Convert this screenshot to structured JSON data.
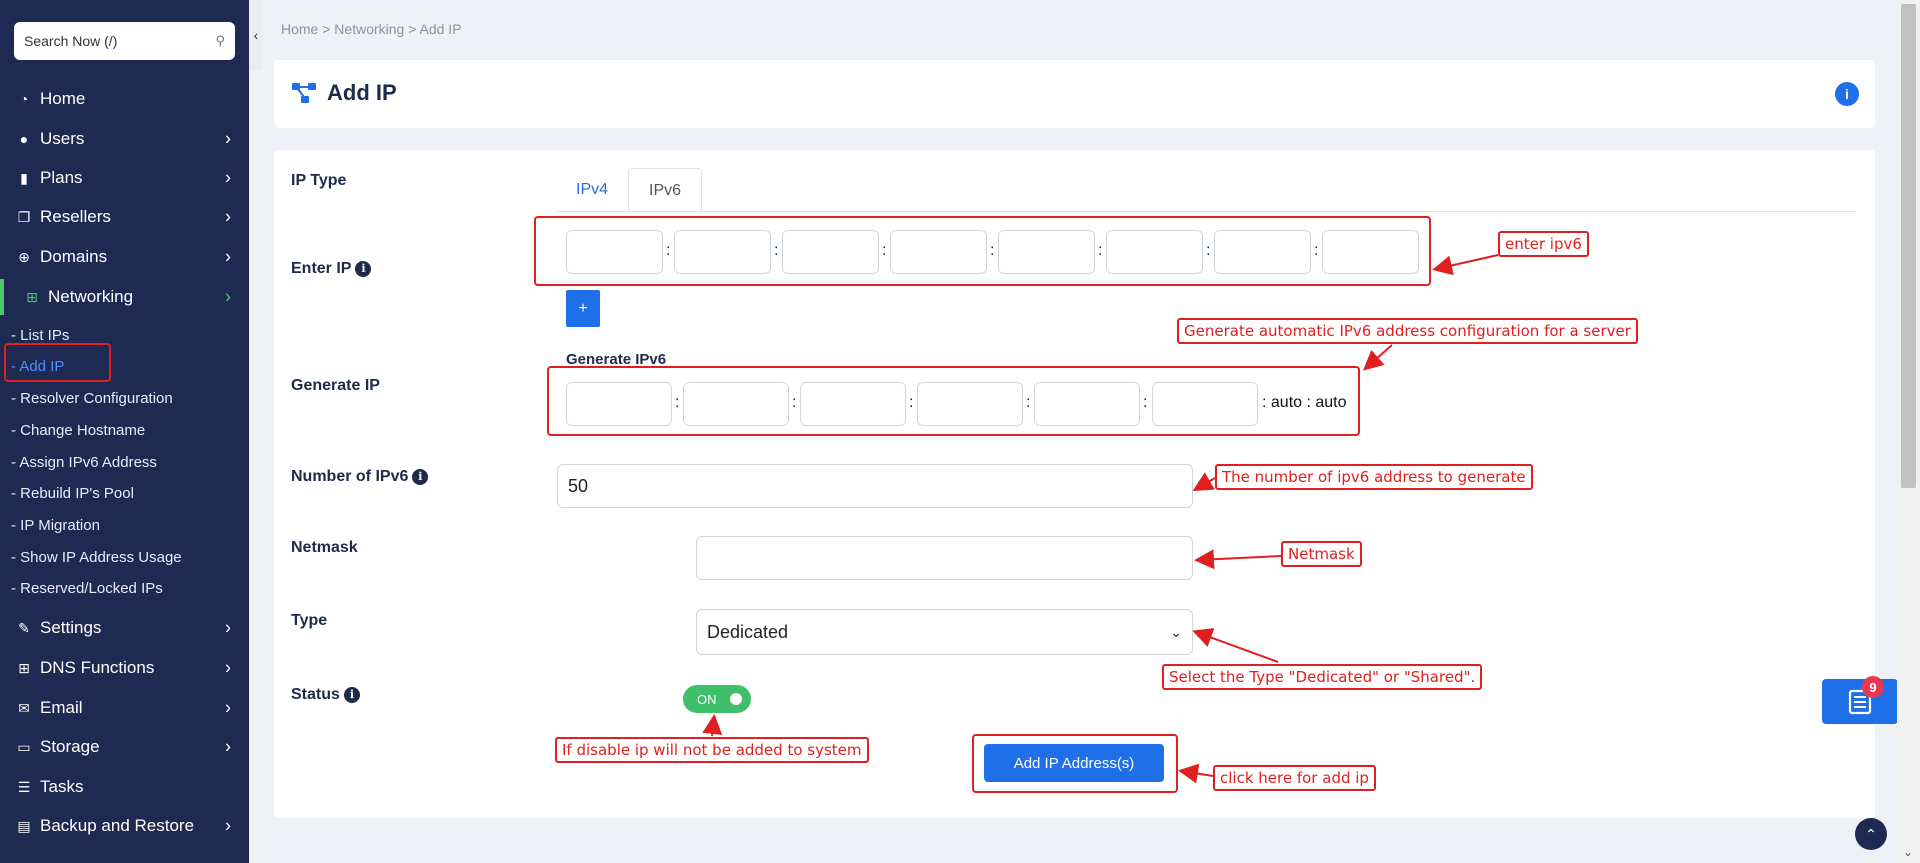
{
  "search": {
    "placeholder": "Search Now (/)",
    "icon": "search-icon"
  },
  "sidebar": {
    "items": [
      {
        "label": "Home",
        "icon": "dashboard-icon",
        "has_chevron": false
      },
      {
        "label": "Users",
        "icon": "user-icon",
        "has_chevron": true
      },
      {
        "label": "Plans",
        "icon": "book-icon",
        "has_chevron": true
      },
      {
        "label": "Resellers",
        "icon": "copy-icon",
        "has_chevron": true
      },
      {
        "label": "Domains",
        "icon": "globe-icon",
        "has_chevron": true
      },
      {
        "label": "Networking",
        "icon": "network-icon",
        "has_chevron": true,
        "active": true
      },
      {
        "label": "Settings",
        "icon": "wrench-icon",
        "has_chevron": true
      },
      {
        "label": "DNS Functions",
        "icon": "sitemap-icon",
        "has_chevron": true
      },
      {
        "label": "Email",
        "icon": "envelope-icon",
        "has_chevron": true
      },
      {
        "label": "Storage",
        "icon": "hdd-icon",
        "has_chevron": true
      },
      {
        "label": "Tasks",
        "icon": "list-icon",
        "has_chevron": false
      },
      {
        "label": "Backup and Restore",
        "icon": "server-icon",
        "has_chevron": true
      }
    ],
    "networking_sub": [
      "- List IPs",
      "- Add IP",
      "- Resolver Configuration",
      "- Change Hostname",
      "- Assign IPv6 Address",
      "- Rebuild IP's Pool",
      "- IP Migration",
      "- Show IP Address Usage",
      "- Reserved/Locked IPs"
    ]
  },
  "breadcrumb": "Home > Networking > Add IP",
  "header": {
    "title": "Add IP",
    "title_icon": "network-icon",
    "info_icon": "info-icon"
  },
  "form": {
    "ip_type_label": "IP Type",
    "tabs": [
      "IPv4",
      "IPv6"
    ],
    "selected_tab": "IPv6",
    "enter_ip_label": "Enter IP",
    "add_segment_label": "+",
    "generate_ip_label": "Generate IP",
    "generate_ipv6_label": "Generate IPv6",
    "generate_suffix": ": auto : auto",
    "number_label": "Number of IPv6",
    "number_value": "50",
    "netmask_label": "Netmask",
    "netmask_value": "",
    "type_label": "Type",
    "type_value": "Dedicated",
    "status_label": "Status",
    "status_toggle": "ON",
    "submit_label": "Add IP Address(s)"
  },
  "annotations": {
    "enter_ipv6": "enter ipv6",
    "generate": "Generate automatic IPv6 address configuration for a server",
    "number": "The number of ipv6  address to generate",
    "netmask": "Netmask",
    "type": "Select the Type \"Dedicated\" or \"Shared\".",
    "status": "If disable ip will not be added to system",
    "click": "click here for add ip"
  },
  "notification_count": "9",
  "colors": {
    "sidebar": "#1e2a52",
    "primary": "#1e6fe8",
    "active_green": "#4cc86a",
    "annotation_red": "#e01f1f"
  }
}
